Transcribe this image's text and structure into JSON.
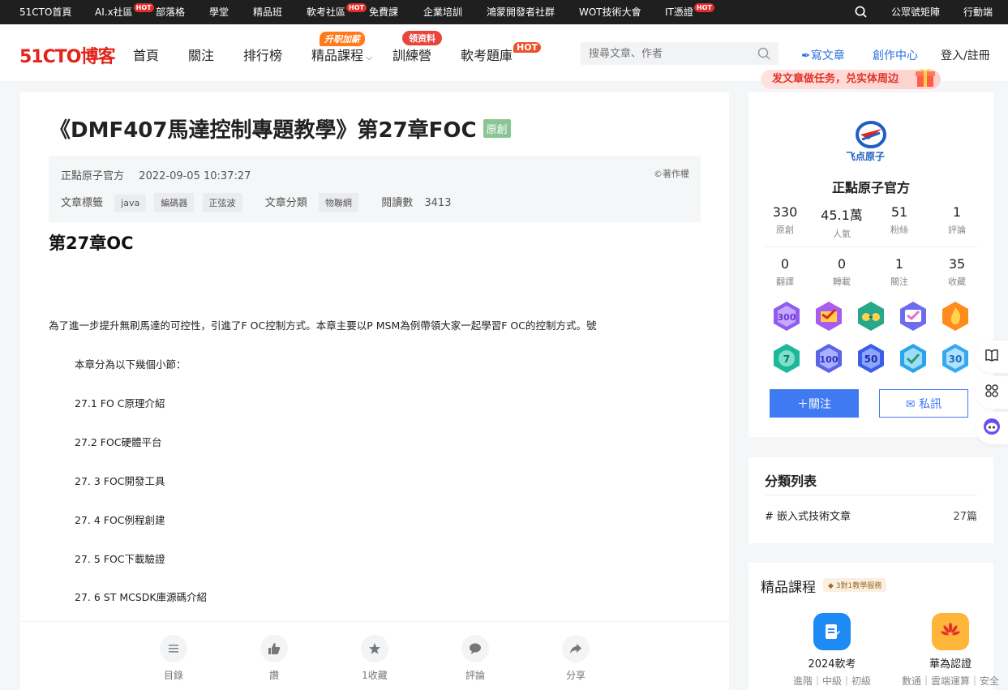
{
  "topbar": {
    "items": [
      "51CTO首頁",
      "AI.x社區",
      "部落格",
      "學堂",
      "精品班",
      "軟考社區",
      "免費課",
      "企業培訓",
      "鴻蒙開發者社群",
      "WOT技術大會",
      "IT憑證"
    ],
    "hot": "HOT",
    "right": [
      "公眾號矩陣",
      "行動端"
    ]
  },
  "header": {
    "logo": "51CTO博客",
    "nav": [
      "首頁",
      "關注",
      "排行榜",
      "精品課程",
      "訓練營",
      "軟考題庫"
    ],
    "badge_course": "升职加薪",
    "badge_camp": "领资料",
    "badge_hot": "HOT",
    "search_placeholder": "搜尋文章、作者",
    "write": "寫文章",
    "creator": "創作中心",
    "login": "登入/註冊",
    "promo": "发文章做任务，兑实体周边"
  },
  "article": {
    "title": "《DMF407馬達控制專題教學》第27章FOC",
    "original": "原創",
    "author": "正點原子官方",
    "date": "2022-09-05 10:37:27",
    "copyright": "©著作權",
    "tags_label": "文章標籤",
    "tags": [
      "java",
      "編碼器",
      "正弦波"
    ],
    "category_label": "文章分類",
    "category": "物聯網",
    "reads_label": "閱讀數",
    "reads": "3413",
    "heading": "第27章OC",
    "intro": "為了進一步提升無刷馬達的可控性，引進了F OC控制方式。本章主要以P MSM為例帶領大家一起學習F OC的控制方式。號",
    "sections_intro": "本章分為以下幾個小節：",
    "sections": [
      "27.1 FO C原理介紹",
      "27.2 FOC硬體平台",
      "27. 3 FOC開發工具",
      "27. 4 FOC例程創建",
      "27. 5 FOC下載驗證",
      "27. 6 ST MCSDK庫源碼介紹"
    ]
  },
  "actions": [
    "目錄",
    "讚",
    "1收藏",
    "評論",
    "分享"
  ],
  "profile": {
    "name": "正點原子官方",
    "stats": [
      {
        "n": "330",
        "k": "原創"
      },
      {
        "n": "45.1萬",
        "k": "人氣"
      },
      {
        "n": "51",
        "k": "粉絲"
      },
      {
        "n": "1",
        "k": "評論"
      },
      {
        "n": "0",
        "k": "翻譯"
      },
      {
        "n": "0",
        "k": "轉載"
      },
      {
        "n": "1",
        "k": "關注"
      },
      {
        "n": "35",
        "k": "收藏"
      }
    ],
    "medals": [
      "300",
      "",
      "",
      "",
      "",
      "7",
      "100",
      "50",
      "",
      "30"
    ],
    "follow": "＋關注",
    "message": "私訊"
  },
  "categories": {
    "title": "分類列表",
    "items": [
      {
        "name": "# 嵌入式技術文章",
        "count": "27篇"
      }
    ]
  },
  "courses": {
    "title": "精品課程",
    "pill": "3對1教學服務",
    "items": [
      {
        "name": "2024軟考",
        "sub": "進階｜中級｜初級"
      },
      {
        "name": "華為認證",
        "sub": "數通｜雲端運算｜安全"
      }
    ]
  },
  "colors": {
    "accent": "#3f7af2",
    "brand": "#e1251b",
    "hot": "#e22d2d"
  }
}
